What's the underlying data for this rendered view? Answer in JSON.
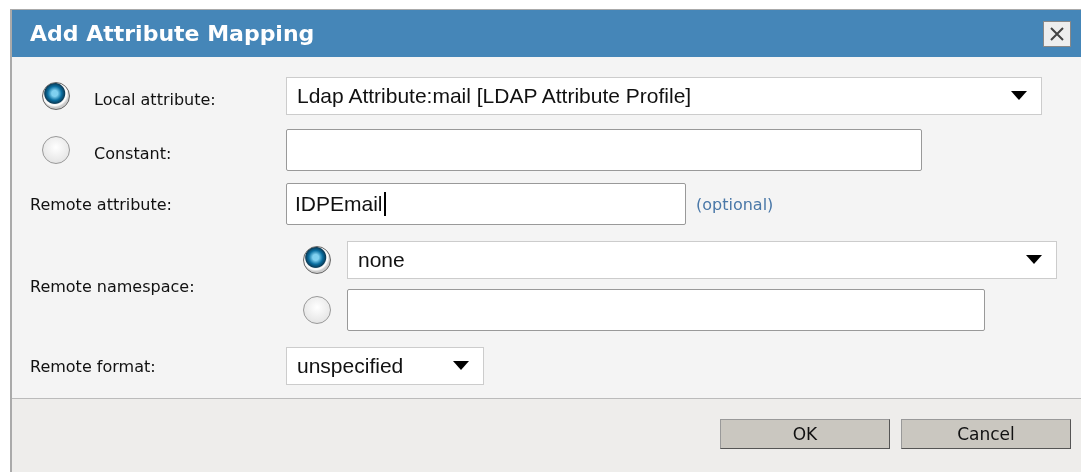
{
  "window": {
    "title": "Add Attribute Mapping"
  },
  "local_attribute": {
    "label": "Local attribute:",
    "selected": true,
    "value": "Ldap Attribute:mail [LDAP Attribute Profile]"
  },
  "constant": {
    "label": "Constant:",
    "selected": false
  },
  "remote_attribute": {
    "label": "Remote attribute:",
    "value": "IDPEmail",
    "focused": true,
    "hint": "(optional)"
  },
  "remote_namespace": {
    "label": "Remote namespace:",
    "options": [
      {
        "kind": "select",
        "selected": true,
        "value": "none"
      },
      {
        "kind": "text",
        "selected": false
      }
    ]
  },
  "remote_format": {
    "label": "Remote format:",
    "value": "unspecified"
  },
  "buttons": [
    "OK",
    "Cancel"
  ]
}
